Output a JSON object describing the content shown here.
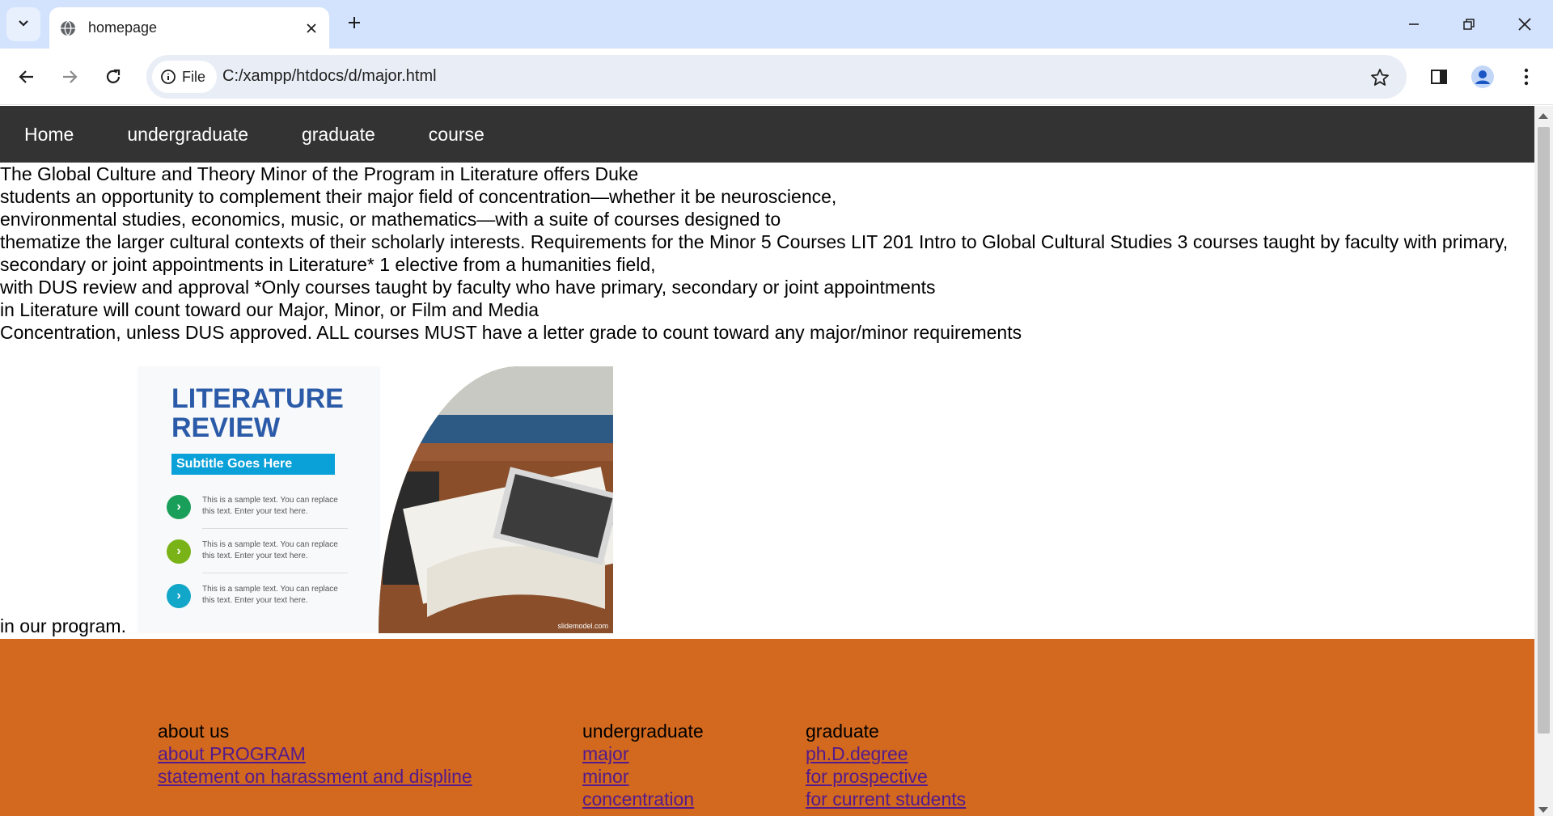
{
  "browser": {
    "tab_title": "homepage",
    "site_chip_label": "File",
    "url": "C:/xampp/htdocs/d/major.html"
  },
  "nav": {
    "items": [
      "Home",
      "undergraduate",
      "graduate",
      "course"
    ]
  },
  "content": {
    "lines": [
      "The Global Culture and Theory Minor of the Program in Literature offers Duke",
      "students an opportunity to complement their major field of concentration—whether it be neuroscience,",
      "environmental studies, economics, music, or mathematics—with a suite of courses designed to",
      "thematize the larger cultural contexts of their scholarly interests. Requirements for the Minor 5 Courses LIT 201 Intro to Global Cultural Studies 3 courses taught by faculty with primary,",
      "secondary or joint appointments in Literature* 1 elective from a humanities field,",
      "with DUS review and approval *Only courses taught by faculty who have primary, secondary or joint appointments",
      "in Literature will count toward our Major, Minor, or Film and Media",
      "Concentration, unless DUS approved. ALL courses MUST have a letter grade to count toward any major/minor requirements"
    ],
    "tail": "in our program."
  },
  "figure": {
    "title_line1": "LITERATURE",
    "title_line2": "REVIEW",
    "subtitle": "Subtitle Goes Here",
    "items": [
      {
        "text": "This is a sample text. You can replace this text. Enter your text here.",
        "color": "#1a9f5a"
      },
      {
        "text": "This is a sample text. You can replace this text. Enter your text here.",
        "color": "#7ab317"
      },
      {
        "text": "This is a sample text. You can replace this text. Enter your text here.",
        "color": "#12a6c8"
      }
    ],
    "credit": "slidemodel.com"
  },
  "footer": {
    "columns": [
      {
        "heading": "about us",
        "links": [
          "about PROGRAM",
          "statement on harassment and displine"
        ]
      },
      {
        "heading": "undergraduate",
        "links": [
          "major",
          "minor",
          "concentration"
        ]
      },
      {
        "heading": "graduate",
        "links": [
          "ph.D.degree",
          "for prospective",
          "for current students"
        ]
      }
    ],
    "background": "#d2691e"
  }
}
